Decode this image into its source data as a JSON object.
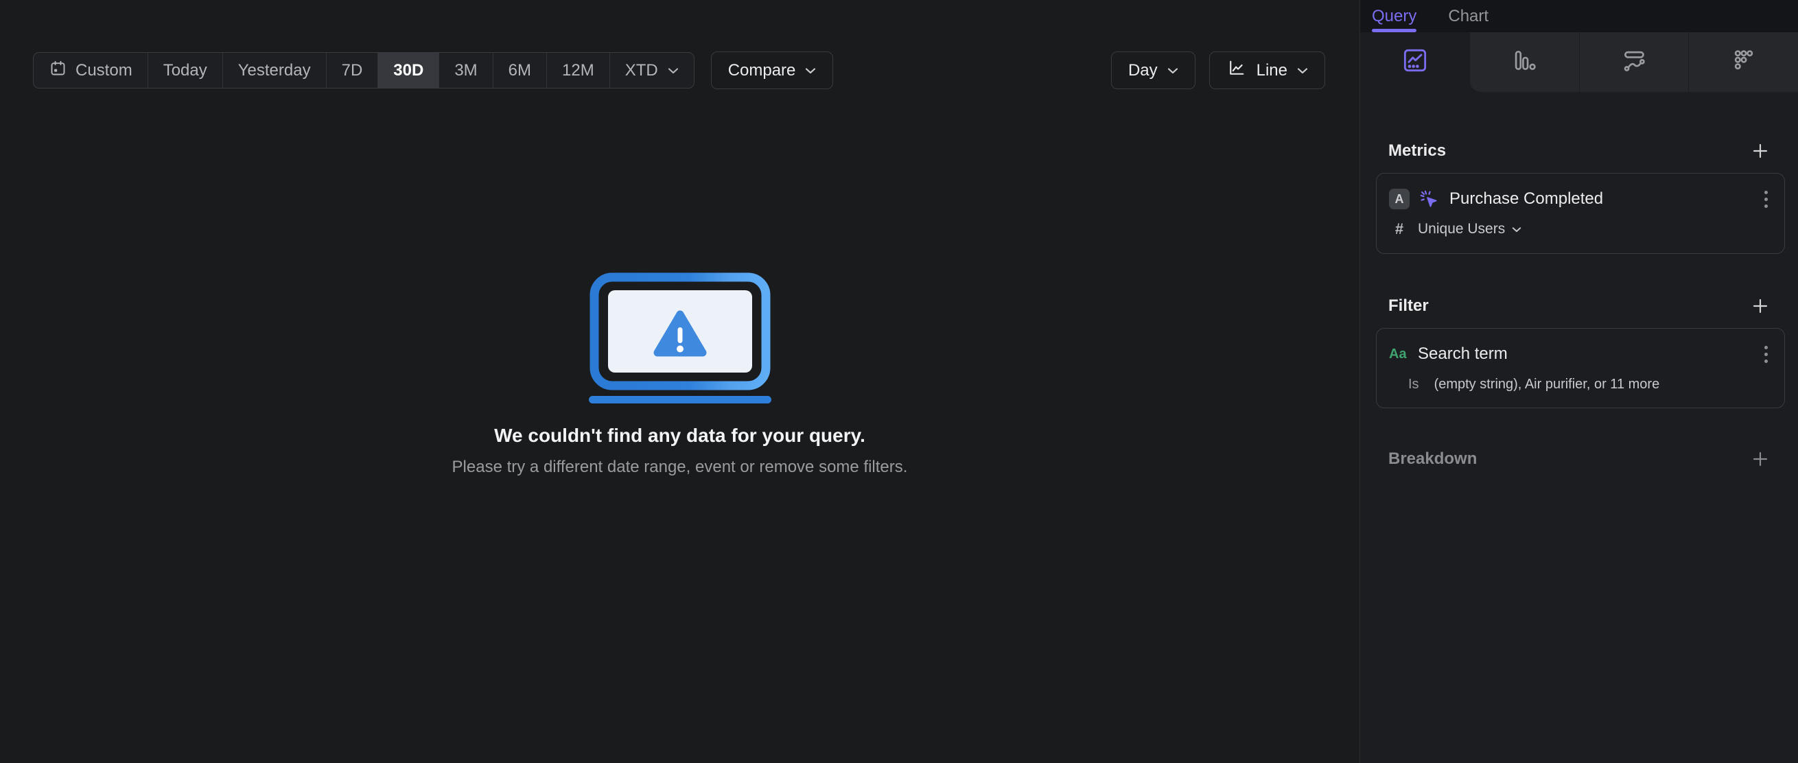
{
  "colors": {
    "accent": "#7a6df0",
    "property_green": "#3fa36f",
    "illustration_blue": "#2e7fd9",
    "illustration_blue_light": "#5aa7f2",
    "screen_fill": "#edf2f8"
  },
  "toolbar": {
    "ranges": [
      {
        "label": "Custom"
      },
      {
        "label": "Today"
      },
      {
        "label": "Yesterday"
      },
      {
        "label": "7D"
      },
      {
        "label": "30D"
      },
      {
        "label": "3M"
      },
      {
        "label": "6M"
      },
      {
        "label": "12M"
      },
      {
        "label": "XTD"
      }
    ],
    "active_range": "30D",
    "compare_label": "Compare",
    "granularity_label": "Day",
    "chart_type_label": "Line"
  },
  "empty_state": {
    "title": "We couldn't find any data for your query.",
    "subtitle": "Please try a different date range, event or remove some filters."
  },
  "sidebar": {
    "tabs": [
      {
        "label": "Query"
      },
      {
        "label": "Chart"
      }
    ],
    "active_tab": "Query",
    "report_tabs": [
      "insights",
      "funnels",
      "flows",
      "retention"
    ],
    "metrics": {
      "heading": "Metrics",
      "event_letter": "A",
      "event_name": "Purchase Completed",
      "aggregation_prefix": "#",
      "aggregation": "Unique Users"
    },
    "filter": {
      "heading": "Filter",
      "property_type": "Aa",
      "property_name": "Search term",
      "operator": "Is",
      "values": "(empty string), Air purifier, or 11 more"
    },
    "breakdown": {
      "heading": "Breakdown"
    }
  },
  "icons": [
    "calendar-icon",
    "chevron-down-icon",
    "line-chart-icon",
    "insights-chart-icon",
    "funnel-bars-icon",
    "flows-icon",
    "retention-dots-icon",
    "plus-icon",
    "kebab-menu-icon",
    "click-event-icon",
    "warning-laptop-illustration"
  ]
}
